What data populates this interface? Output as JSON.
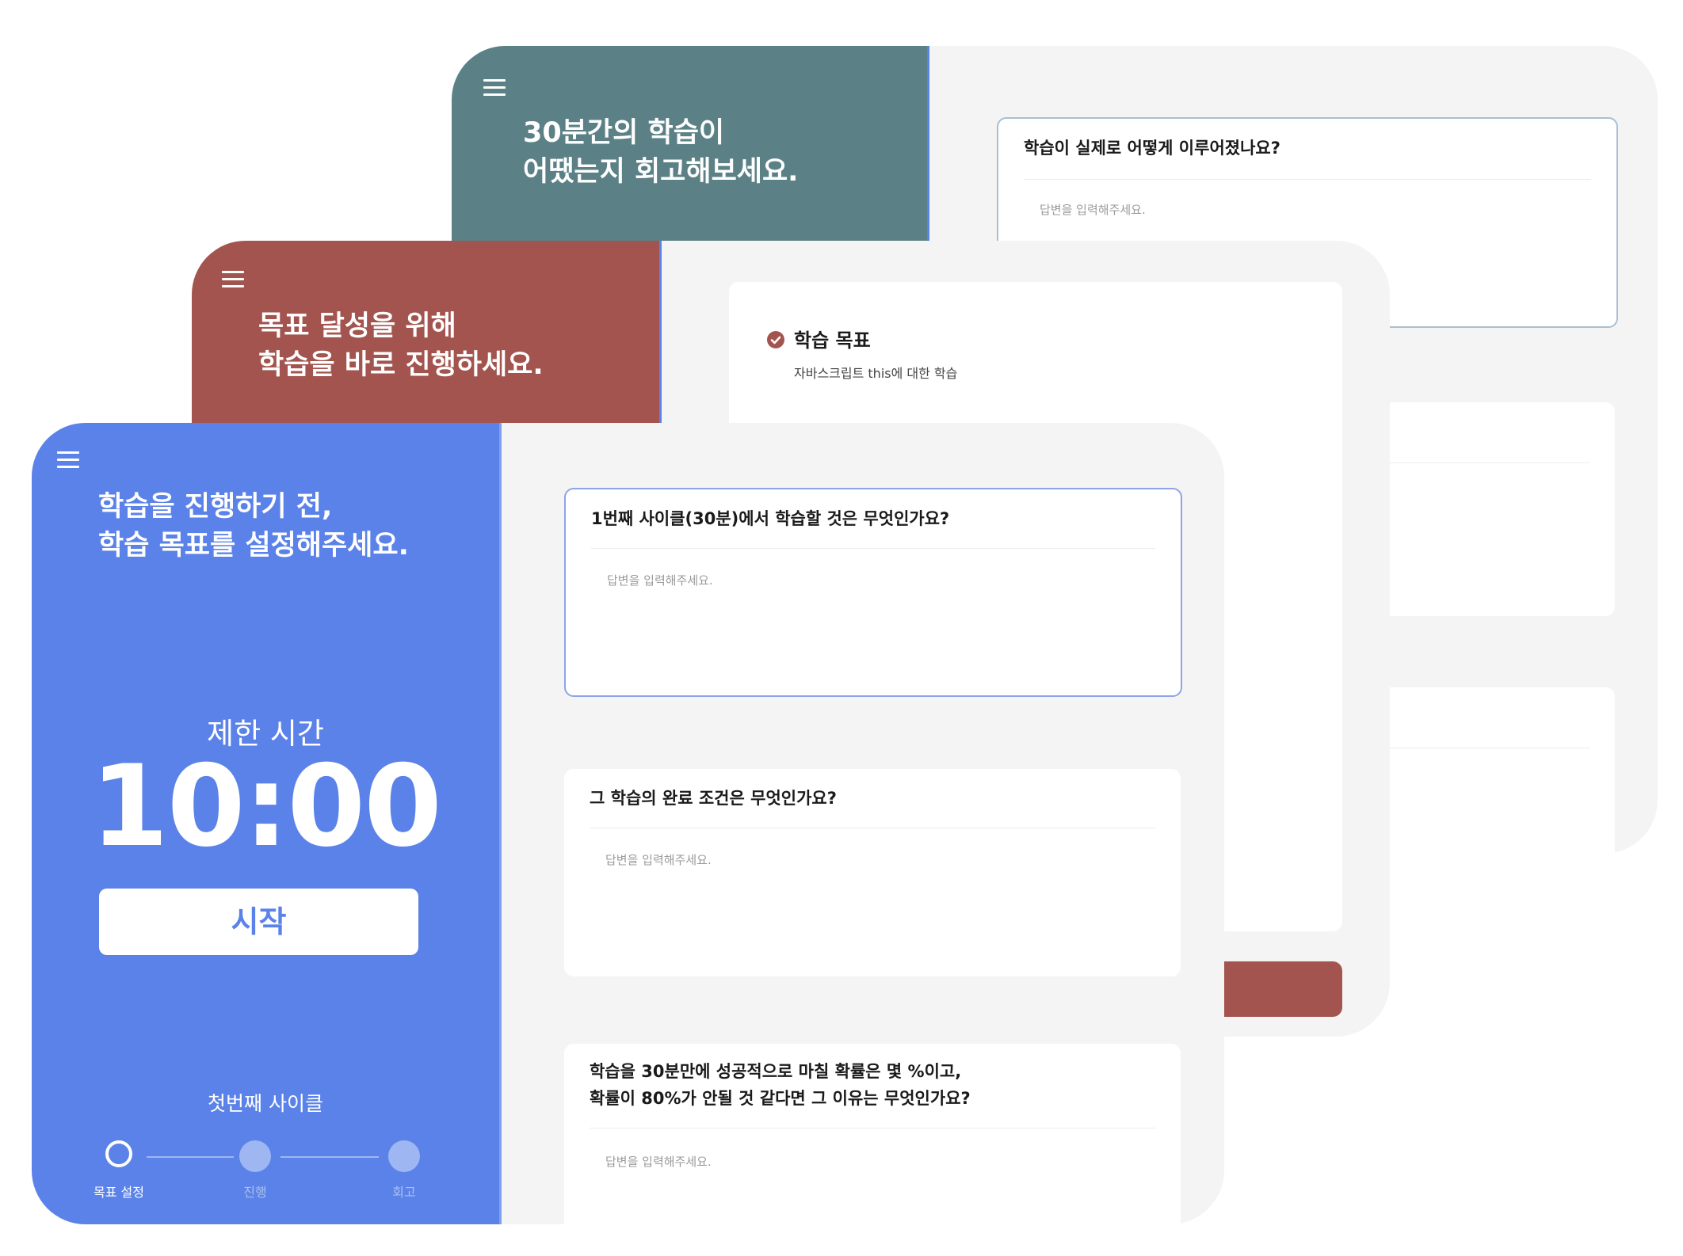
{
  "screens": {
    "retro": {
      "title_lines": [
        "30분간의 학습이",
        "어땠는지 회고해보세요."
      ],
      "colors": {
        "side": "#5b8186"
      },
      "question": "학습이 실제로 어떻게 이루어졌나요?",
      "placeholder": "답변을 입력해주세요."
    },
    "progress": {
      "title_lines": [
        "목표 달성을 위해",
        "학습을 바로 진행하세요."
      ],
      "colors": {
        "side": "#a3544e"
      },
      "goal_heading": "학습 목표",
      "goal_text": "자바스크립트 this에 대한 학습"
    },
    "setup": {
      "title_lines": [
        "학습을 진행하기 전,",
        "학습 목표를 설정해주세요."
      ],
      "colors": {
        "side": "#5b82e8",
        "button_text": "#5b82e8"
      },
      "timer_label": "제한 시간",
      "timer_value": "10:00",
      "start_button": "시작",
      "cycle_label": "첫번째 사이클",
      "steps": [
        "목표 설정",
        "진행",
        "회고"
      ],
      "current_step": 0,
      "questions": [
        {
          "lines": [
            "1번째 사이클(30분)에서 학습할 것은 무엇인가요?"
          ],
          "placeholder": "답변을 입력해주세요."
        },
        {
          "lines": [
            "그 학습의 완료 조건은 무엇인가요?"
          ],
          "placeholder": "답변을 입력해주세요."
        },
        {
          "lines": [
            "학습을 30분만에 성공적으로 마칠 확률은 몇 %이고,",
            "확률이 80%가 안될 것 같다면 그 이유는 무엇인가요?"
          ],
          "placeholder": "답변을 입력해주세요."
        }
      ]
    }
  }
}
